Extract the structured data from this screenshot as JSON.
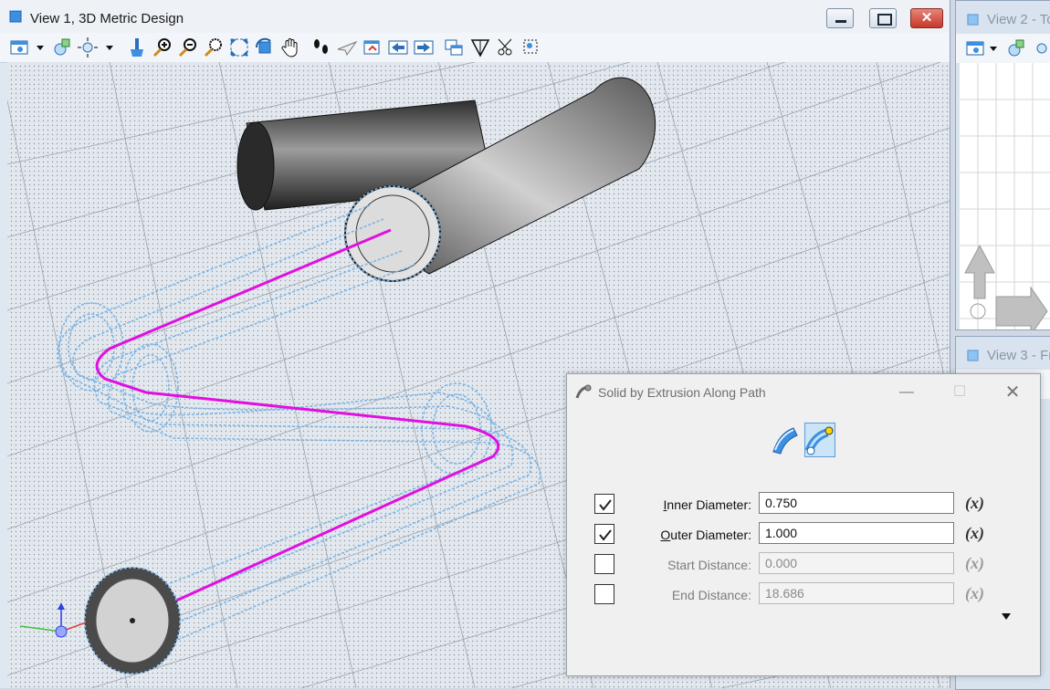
{
  "view1": {
    "title": "View 1, 3D Metric Design",
    "toolbar_icons": [
      "view-attributes-icon",
      "display-style-icon",
      "lighting-icon",
      "update-view-icon",
      "zoom-in-icon",
      "zoom-out-icon",
      "window-area-icon",
      "fit-view-icon",
      "rotate-view-icon",
      "pan-view-icon",
      "walk-icon",
      "fly-icon",
      "view-previous-icon",
      "previous-view-icon",
      "next-view-icon",
      "copy-view-icon",
      "view-perspective-icon",
      "clip-volume-icon",
      "clip-mask-icon"
    ]
  },
  "view2": {
    "title": "View 2 - To"
  },
  "view3": {
    "title": "View 3 - Fr"
  },
  "dialog": {
    "title": "Solid by Extrusion Along Path",
    "modes": [
      "Surface",
      "Pipe"
    ],
    "fields": [
      {
        "label": "Inner Diameter:",
        "accel": "I",
        "rest": "nner Diameter:",
        "value": "0.750",
        "checked": true,
        "enabled": true
      },
      {
        "label": "Outer Diameter:",
        "accel": "O",
        "rest": "uter Diameter:",
        "value": "1.000",
        "checked": true,
        "enabled": true
      },
      {
        "label": "Start Distance:",
        "accel": "",
        "rest": "Start Distance:",
        "value": "0.000",
        "checked": false,
        "enabled": false
      },
      {
        "label": "End Distance:",
        "accel": "",
        "rest": "End Distance:",
        "value": "18.686",
        "checked": false,
        "enabled": false
      }
    ],
    "fx_label": "(x)"
  },
  "colors": {
    "path": "#e010e0",
    "preview": "#7ab4e6",
    "grid_bg": "#dfe7f1"
  }
}
